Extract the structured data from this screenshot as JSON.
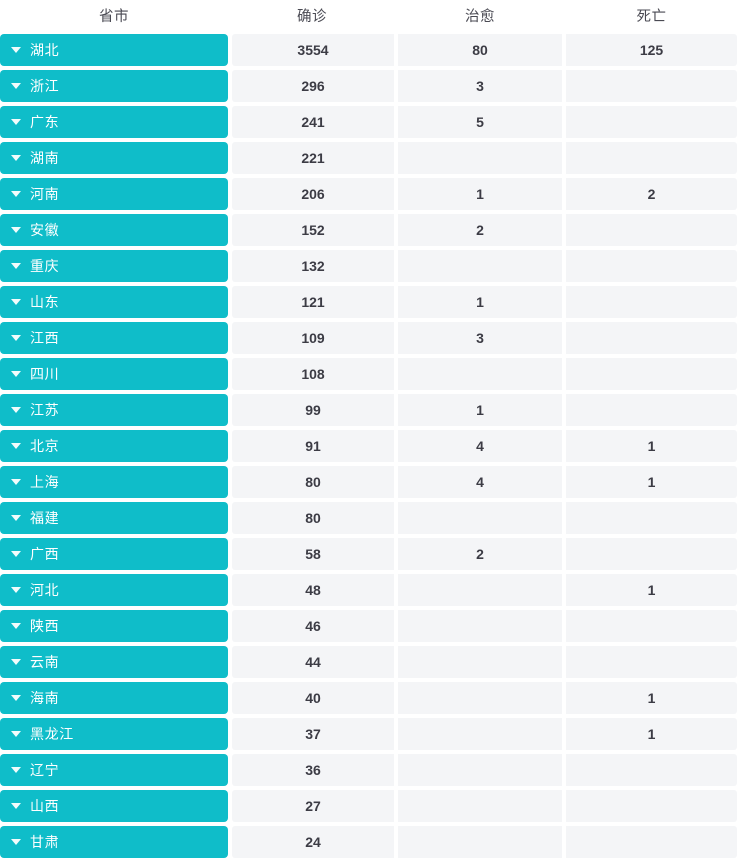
{
  "table": {
    "columns": [
      {
        "key": "province",
        "label": "省市"
      },
      {
        "key": "confirmed",
        "label": "确诊"
      },
      {
        "key": "cured",
        "label": "治愈"
      },
      {
        "key": "deaths",
        "label": "死亡"
      }
    ],
    "icons": {
      "row_expand": "caret-down-icon"
    },
    "colors": {
      "accent_teal": "#0fbdc9",
      "cell_background": "#f4f5f7",
      "page_background": "#ffffff",
      "header_text": "#4a4a53",
      "value_text": "#3c3c45",
      "province_text": "#ffffff"
    },
    "rows": [
      {
        "province": "湖北",
        "confirmed": "3554",
        "cured": "80",
        "deaths": "125"
      },
      {
        "province": "浙江",
        "confirmed": "296",
        "cured": "3",
        "deaths": ""
      },
      {
        "province": "广东",
        "confirmed": "241",
        "cured": "5",
        "deaths": ""
      },
      {
        "province": "湖南",
        "confirmed": "221",
        "cured": "",
        "deaths": ""
      },
      {
        "province": "河南",
        "confirmed": "206",
        "cured": "1",
        "deaths": "2"
      },
      {
        "province": "安徽",
        "confirmed": "152",
        "cured": "2",
        "deaths": ""
      },
      {
        "province": "重庆",
        "confirmed": "132",
        "cured": "",
        "deaths": ""
      },
      {
        "province": "山东",
        "confirmed": "121",
        "cured": "1",
        "deaths": ""
      },
      {
        "province": "江西",
        "confirmed": "109",
        "cured": "3",
        "deaths": ""
      },
      {
        "province": "四川",
        "confirmed": "108",
        "cured": "",
        "deaths": ""
      },
      {
        "province": "江苏",
        "confirmed": "99",
        "cured": "1",
        "deaths": ""
      },
      {
        "province": "北京",
        "confirmed": "91",
        "cured": "4",
        "deaths": "1"
      },
      {
        "province": "上海",
        "confirmed": "80",
        "cured": "4",
        "deaths": "1"
      },
      {
        "province": "福建",
        "confirmed": "80",
        "cured": "",
        "deaths": ""
      },
      {
        "province": "广西",
        "confirmed": "58",
        "cured": "2",
        "deaths": ""
      },
      {
        "province": "河北",
        "confirmed": "48",
        "cured": "",
        "deaths": "1"
      },
      {
        "province": "陕西",
        "confirmed": "46",
        "cured": "",
        "deaths": ""
      },
      {
        "province": "云南",
        "confirmed": "44",
        "cured": "",
        "deaths": ""
      },
      {
        "province": "海南",
        "confirmed": "40",
        "cured": "",
        "deaths": "1"
      },
      {
        "province": "黑龙江",
        "confirmed": "37",
        "cured": "",
        "deaths": "1"
      },
      {
        "province": "辽宁",
        "confirmed": "36",
        "cured": "",
        "deaths": ""
      },
      {
        "province": "山西",
        "confirmed": "27",
        "cured": "",
        "deaths": ""
      },
      {
        "province": "甘肃",
        "confirmed": "24",
        "cured": "",
        "deaths": ""
      }
    ]
  }
}
